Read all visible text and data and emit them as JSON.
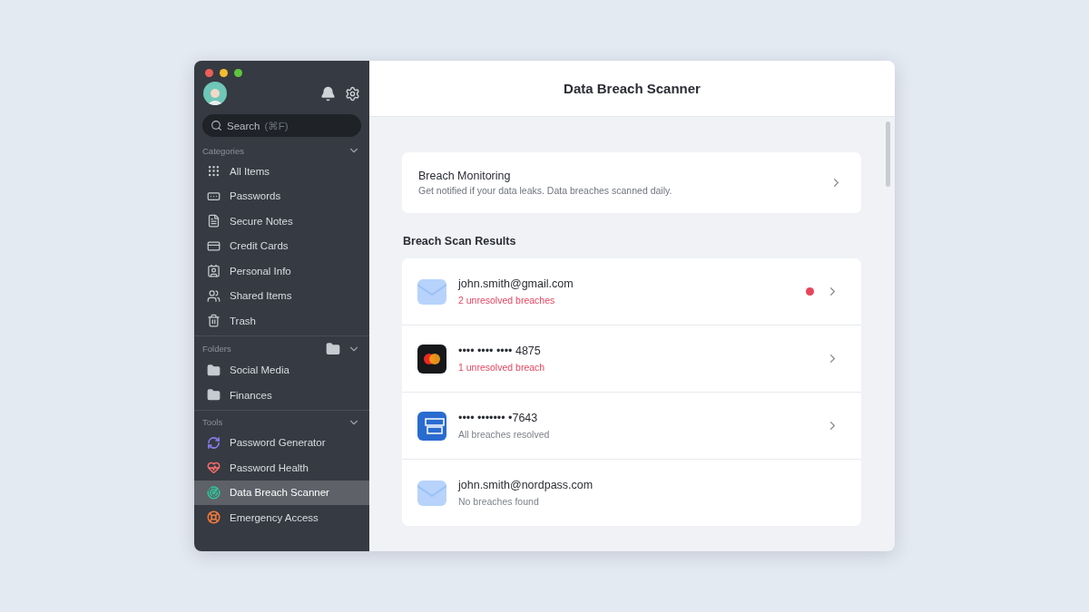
{
  "sidebar": {
    "search": {
      "placeholder": "Search",
      "shortcut": "(⌘F)"
    },
    "categories": {
      "title": "Categories",
      "expanded": true,
      "items": [
        {
          "kind": "all",
          "label": "All Items"
        },
        {
          "kind": "password",
          "label": "Passwords"
        },
        {
          "kind": "note",
          "label": "Secure Notes"
        },
        {
          "kind": "card",
          "label": "Credit Cards"
        },
        {
          "kind": "personal",
          "label": "Personal Info"
        },
        {
          "kind": "shared",
          "label": "Shared Items"
        },
        {
          "kind": "trash",
          "label": "Trash"
        }
      ]
    },
    "folders": {
      "title": "Folders",
      "expanded": true,
      "items": [
        {
          "label": "Social Media"
        },
        {
          "label": "Finances"
        }
      ]
    },
    "tools": {
      "title": "Tools",
      "expanded": true,
      "items": [
        {
          "kind": "generator",
          "label": "Password Generator",
          "selected": false
        },
        {
          "kind": "health",
          "label": "Password Health",
          "selected": false
        },
        {
          "kind": "scanner",
          "label": "Data Breach Scanner",
          "selected": true
        },
        {
          "kind": "emergency",
          "label": "Emergency Access",
          "selected": false
        }
      ]
    }
  },
  "main": {
    "title": "Data Breach Scanner",
    "monitoring": {
      "title": "Breach Monitoring",
      "description": "Get notified if your data leaks. Data breaches scanned daily."
    },
    "results_heading": "Breach Scan Results",
    "results": [
      {
        "kind": "email",
        "title": "john.smith@gmail.com",
        "status": "2 unresolved breaches",
        "alert": true,
        "flagged": true,
        "has_details": true
      },
      {
        "kind": "mastercard",
        "title": "•••• •••• •••• 4875",
        "status": "1 unresolved breach",
        "alert": true,
        "flagged": false,
        "has_details": true
      },
      {
        "kind": "amex",
        "title": "•••• ••••••• •7643",
        "status": "All breaches resolved",
        "alert": false,
        "flagged": false,
        "has_details": true
      },
      {
        "kind": "email",
        "title": "john.smith@nordpass.com",
        "status": "No breaches found",
        "alert": false,
        "flagged": false,
        "has_details": false
      }
    ]
  }
}
